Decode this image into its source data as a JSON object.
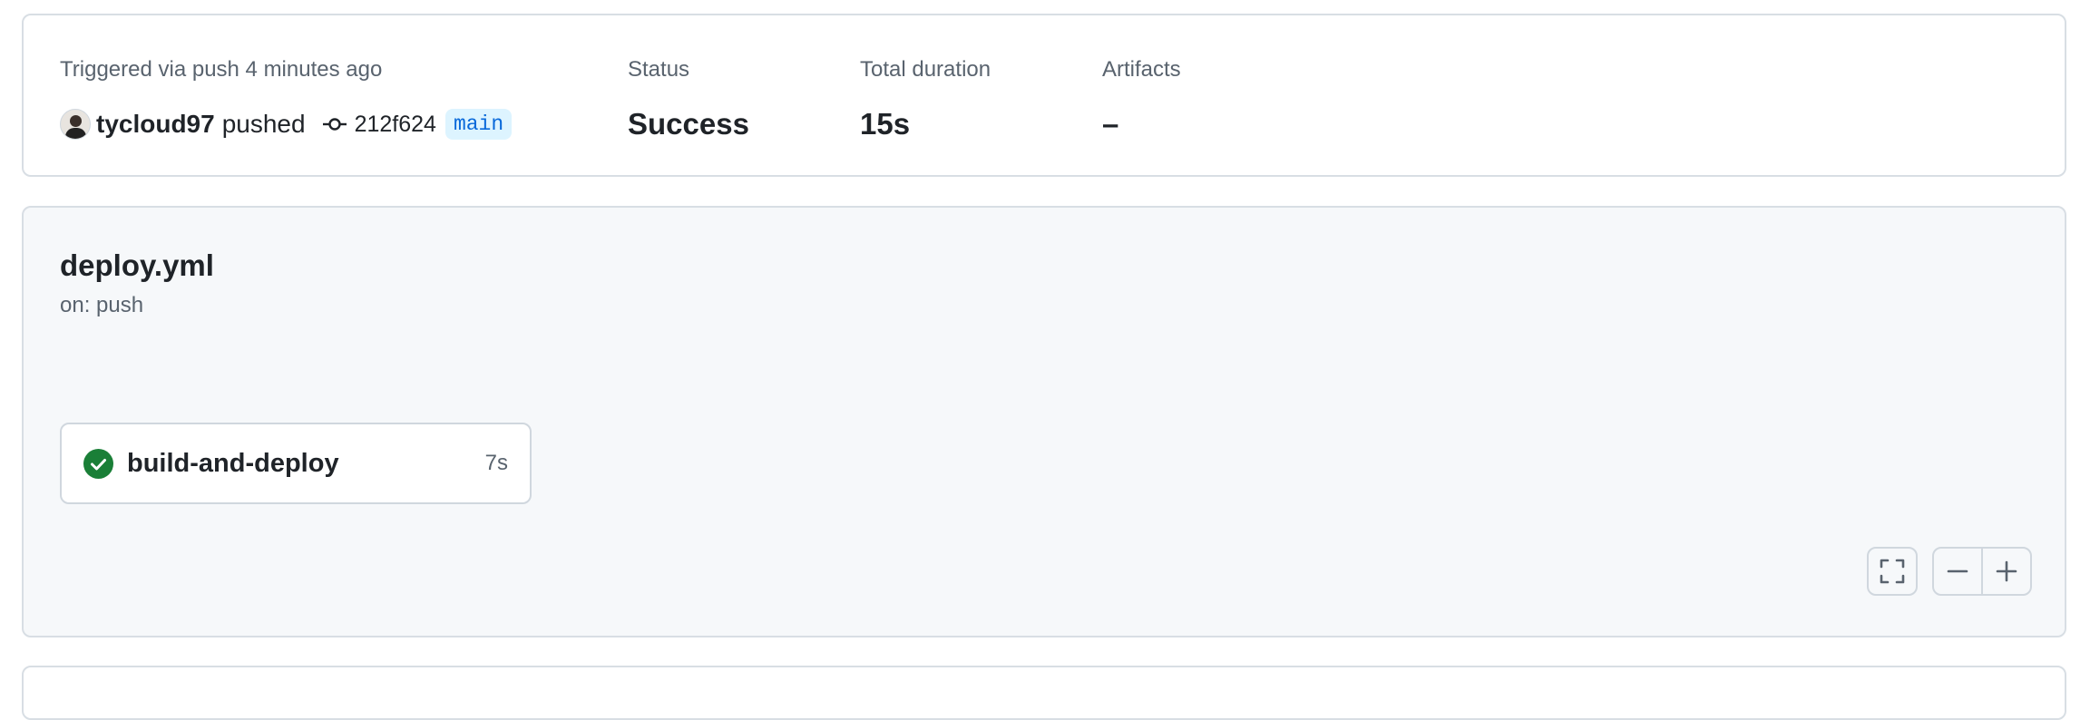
{
  "summary": {
    "trigger_label": "Triggered via push 4 minutes ago",
    "actor": "tycloud97",
    "action": "pushed",
    "commit_sha": "212f624",
    "branch": "main",
    "status_label": "Status",
    "status_value": "Success",
    "duration_label": "Total duration",
    "duration_value": "15s",
    "artifacts_label": "Artifacts",
    "artifacts_value": "–"
  },
  "workflow": {
    "file": "deploy.yml",
    "trigger": "on: push",
    "jobs": [
      {
        "name": "build-and-deploy",
        "duration": "7s",
        "status": "success"
      }
    ]
  },
  "colors": {
    "success": "#1a7f37",
    "branch_text": "#0969da",
    "branch_bg": "#ddf4ff"
  },
  "icons": {
    "commit": "git-commit-icon",
    "job_status": "check-circle-fill-icon",
    "fullscreen": "screen-full-icon",
    "zoom_out": "dash-icon",
    "zoom_in": "plus-icon"
  }
}
